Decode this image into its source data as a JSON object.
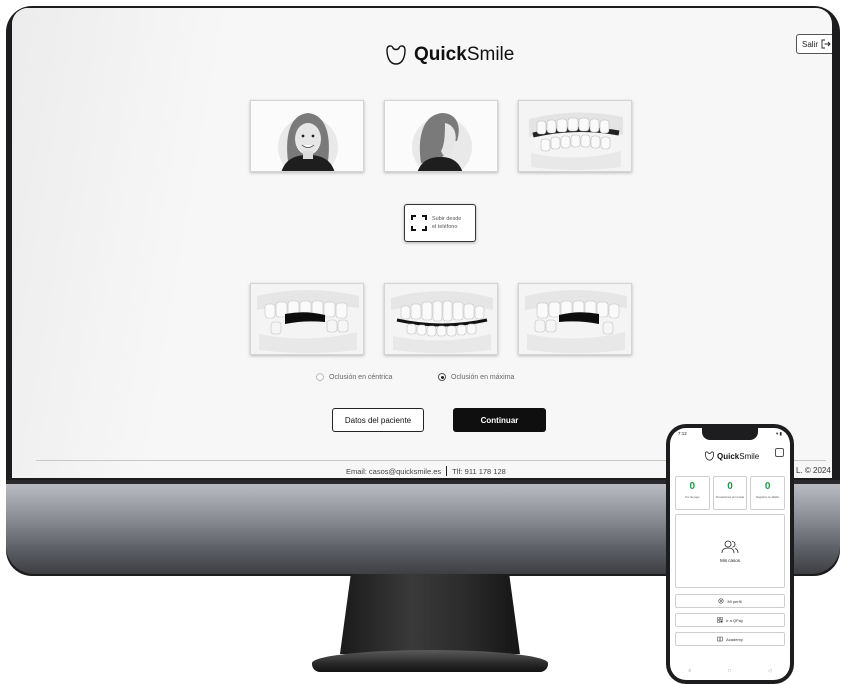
{
  "app": {
    "logo": {
      "brand_bold": "Quick",
      "brand_regular": "Smile"
    },
    "exit_label": "Salir"
  },
  "upload": {
    "label": "Subir desde\nel teléfono"
  },
  "photos": {
    "face_front": "face-front-photo",
    "face_profile": "face-profile-photo",
    "teeth_side_open": "teeth-side-photo",
    "bite_right": "bite-right-photo",
    "bite_front": "bite-front-photo",
    "bite_left": "bite-left-photo"
  },
  "occlusion": {
    "options": [
      {
        "label": "Oclusión en céntrica",
        "selected": false
      },
      {
        "label": "Oclusión en máxima",
        "selected": true
      }
    ]
  },
  "actions": {
    "patient_data": "Datos del paciente",
    "continue": "Continuar"
  },
  "footer": {
    "email": "Email: casos@quicksmile.es",
    "phone": "Tlf: 911 178 128",
    "copyright": "L. © 2024"
  },
  "phone_app": {
    "status_time": "7:12",
    "brand_bold": "Quick",
    "brand_regular": "Smile",
    "stats": [
      {
        "value": "0",
        "label": "Por de pago"
      },
      {
        "value": "0",
        "label": "Simulaciones por revisar"
      },
      {
        "value": "0",
        "label": "Registros en alfalso"
      }
    ],
    "cases_label": "Mis casos",
    "menu": [
      {
        "label": "Mi perfil",
        "icon": "gear-icon"
      },
      {
        "label": "Ir a QPay",
        "icon": "qr-icon"
      },
      {
        "label": "Academy",
        "icon": "book-icon"
      }
    ]
  },
  "colors": {
    "accent_dark": "#0f0f0f",
    "stat_green": "#1f9a4a",
    "screen_bg": "#f7f7f7"
  }
}
